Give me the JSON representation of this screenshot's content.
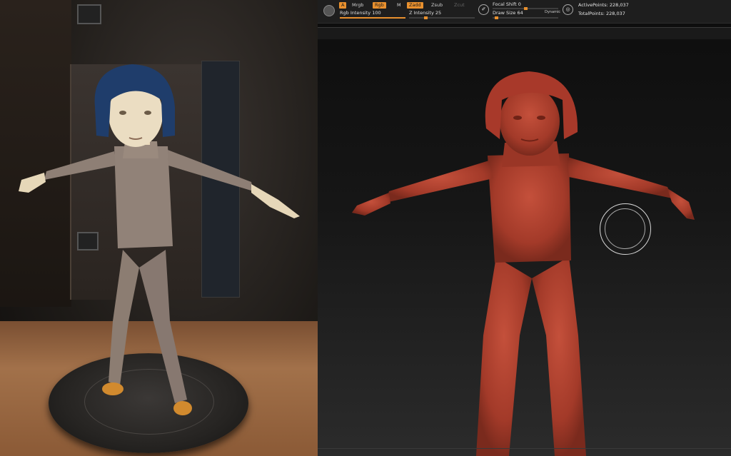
{
  "toolbar": {
    "logo_icon": "zbrush-logo-icon",
    "btn_a": "A",
    "btn_mrgb": "Mrgb",
    "btn_rgb": "Rgb",
    "btn_m": "M",
    "btn_zadd": "Zadd",
    "btn_zsub": "Zsub",
    "btn_zcut": "Zcut",
    "rgb_intensity_label": "Rgb Intensity",
    "rgb_intensity_value": "100",
    "z_intensity_label": "Z Intensity",
    "z_intensity_value": "25",
    "focal_shift_label": "Focal Shift",
    "focal_shift_value": "0",
    "draw_size_label": "Draw Size",
    "draw_size_value": "64",
    "dynamic_label": "Dynamic",
    "active_points_label": "ActivePoints:",
    "active_points_value": "228,037",
    "total_points_label": "TotalPoints:",
    "total_points_value": "228,037",
    "rgb_intensity_level": 1.0,
    "z_intensity_level": 0.25,
    "focal_shift_level": 0.5,
    "draw_size_level": 0.05
  },
  "colors": {
    "accent": "#e8902e",
    "sculpt_clay": "#b6412f",
    "toolbar_bg": "#1e1e1e"
  }
}
